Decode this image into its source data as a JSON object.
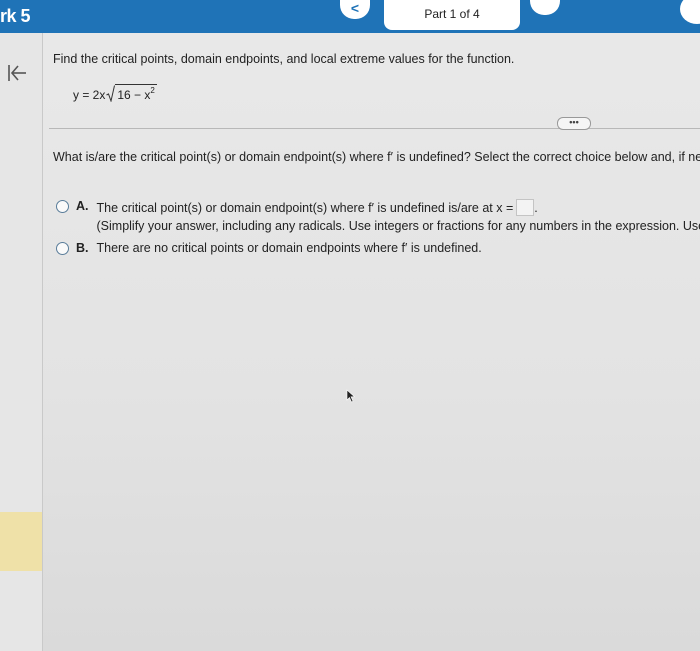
{
  "header": {
    "assignment_title": "rk 5",
    "prev_label": "<",
    "part_label": "Part 1 of 4"
  },
  "problem": {
    "instruction": "Find the critical points, domain endpoints, and local extreme values for the function.",
    "equation": {
      "lhs": "y = 2x",
      "radicand": "16 − x",
      "exponent": "2"
    },
    "more_label": "•••"
  },
  "question": {
    "text": "What is/are the critical point(s) or domain endpoint(s) where f′ is undefined? Select the correct choice below and, if ne",
    "choices": [
      {
        "letter": "A.",
        "text": "The critical point(s) or domain endpoint(s) where f′ is undefined is/are at x =",
        "hint": "(Simplify your answer, including any radicals. Use integers or fractions for any numbers in the expression. Use",
        "answer_value": ""
      },
      {
        "letter": "B.",
        "text": "There are no critical points or domain endpoints where f′ is undefined."
      }
    ]
  },
  "colors": {
    "header_bg": "#1f73b7",
    "rail_highlight": "#efe1a8"
  },
  "icons": {
    "collapse": "collapse-left-icon",
    "cursor": "mouse-pointer-icon"
  }
}
